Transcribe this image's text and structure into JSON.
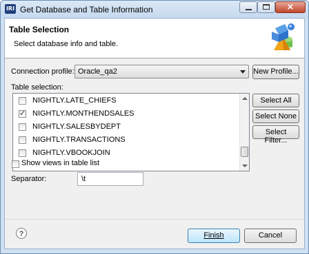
{
  "window": {
    "app_logo": "IRI",
    "title": "Get Database and Table Information",
    "close_glyph": "×"
  },
  "banner": {
    "title": "Table Selection",
    "description": "Select database info and table.",
    "icon": "database-shapes-icon"
  },
  "connection": {
    "label": "Connection profile:",
    "value": "Oracle_qa2",
    "new_profile_button": "New Profile..."
  },
  "table_selection": {
    "label": "Table selection:",
    "rows": [
      {
        "name": "NIGHTLY.LATE_CHIEFS",
        "checked": false
      },
      {
        "name": "NIGHTLY.MONTHENDSALES",
        "checked": true
      },
      {
        "name": "NIGHTLY.SALESBYDEPT",
        "checked": false
      },
      {
        "name": "NIGHTLY.TRANSACTIONS",
        "checked": false
      },
      {
        "name": "NIGHTLY.VBOOKJOIN",
        "checked": false
      }
    ],
    "select_all_button": "Select All",
    "select_none_button": "Select None",
    "select_filter_button": "Select Filter..."
  },
  "show_views": {
    "label": "Show views in table list",
    "checked": false
  },
  "separator": {
    "label": "Separator:",
    "value": "\\t"
  },
  "footer": {
    "help": "?",
    "finish_button": "Finish",
    "cancel_button": "Cancel"
  }
}
